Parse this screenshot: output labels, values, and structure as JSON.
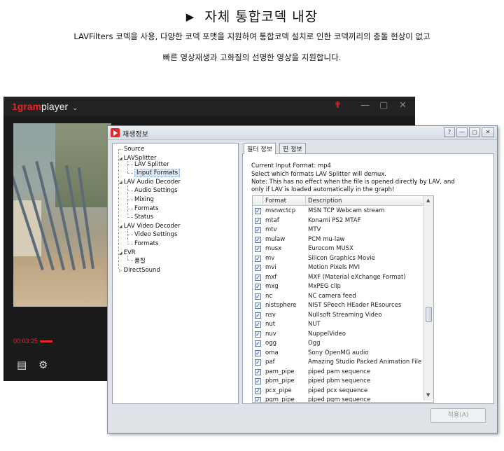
{
  "header": {
    "title": "자체 통합코덱 내장",
    "line1": "LAVFilters 코덱을 사용, 다양한 코덱 포맷을 지원하여 통합코덱 설치로 인한 코덱끼리의 충돌 현상이 없고",
    "line2": "빠른 영상재생과 고화질의 선명한 영상을 지원합니다."
  },
  "player": {
    "brand": "1gram",
    "name": "player",
    "time": "00:03:25",
    "progress_fraction": 0.05
  },
  "dialog": {
    "title": "재생정보",
    "apply_label": "적용(A)",
    "tabs": [
      "필터 정보",
      "핀 정보"
    ],
    "tree": {
      "source": "Source",
      "lav_splitter": "LAVSplitter",
      "lav_splitter_child": "LAV Splitter",
      "input_formats": "Input Formats",
      "lav_audio": "LAV Audio Decoder",
      "audio_settings": "Audio Settings",
      "mixing": "Mixing",
      "audio_formats": "Formats",
      "status": "Status",
      "lav_video": "LAV Video Decoder",
      "video_settings": "Video Settings",
      "video_formats": "Formats",
      "evr": "EVR",
      "evr_child": "품질",
      "directsound": "DirectSound"
    },
    "info": {
      "current": "Current Input Format:   mp4",
      "select": "Select which formats LAV Splitter will demux.",
      "note1": "Note: This has no effect when the file is opened directly by LAV, and",
      "note2": "only if LAV is loaded automatically in the graph!"
    },
    "columns": [
      "Format",
      "Description"
    ],
    "rows": [
      {
        "format": "msnwctcp",
        "desc": "MSN TCP Webcam stream"
      },
      {
        "format": "mtaf",
        "desc": "Konami PS2 MTAF"
      },
      {
        "format": "mtv",
        "desc": "MTV"
      },
      {
        "format": "mulaw",
        "desc": "PCM mu-law"
      },
      {
        "format": "musx",
        "desc": "Eurocom MUSX"
      },
      {
        "format": "mv",
        "desc": "Silicon Graphics Movie"
      },
      {
        "format": "mvi",
        "desc": "Motion Pixels MVI"
      },
      {
        "format": "mxf",
        "desc": "MXF (Material eXchange Format)"
      },
      {
        "format": "mxg",
        "desc": "MxPEG clip"
      },
      {
        "format": "nc",
        "desc": "NC camera feed"
      },
      {
        "format": "nistsphere",
        "desc": "NIST SPeech HEader REsources"
      },
      {
        "format": "nsv",
        "desc": "Nullsoft Streaming Video"
      },
      {
        "format": "nut",
        "desc": "NUT"
      },
      {
        "format": "nuv",
        "desc": "NuppelVideo"
      },
      {
        "format": "ogg",
        "desc": "Ogg"
      },
      {
        "format": "oma",
        "desc": "Sony OpenMG audio"
      },
      {
        "format": "paf",
        "desc": "Amazing Studio Packed Animation File"
      },
      {
        "format": "pam_pipe",
        "desc": "piped pam sequence"
      },
      {
        "format": "pbm_pipe",
        "desc": "piped pbm sequence"
      },
      {
        "format": "pcx_pipe",
        "desc": "piped pcx sequence"
      },
      {
        "format": "pgm_pipe",
        "desc": "piped pgm sequence"
      }
    ]
  },
  "colors": {
    "accent": "#e8242b",
    "player_bg": "#1a1a1a",
    "dialog_bg": "#dfe3e8"
  }
}
